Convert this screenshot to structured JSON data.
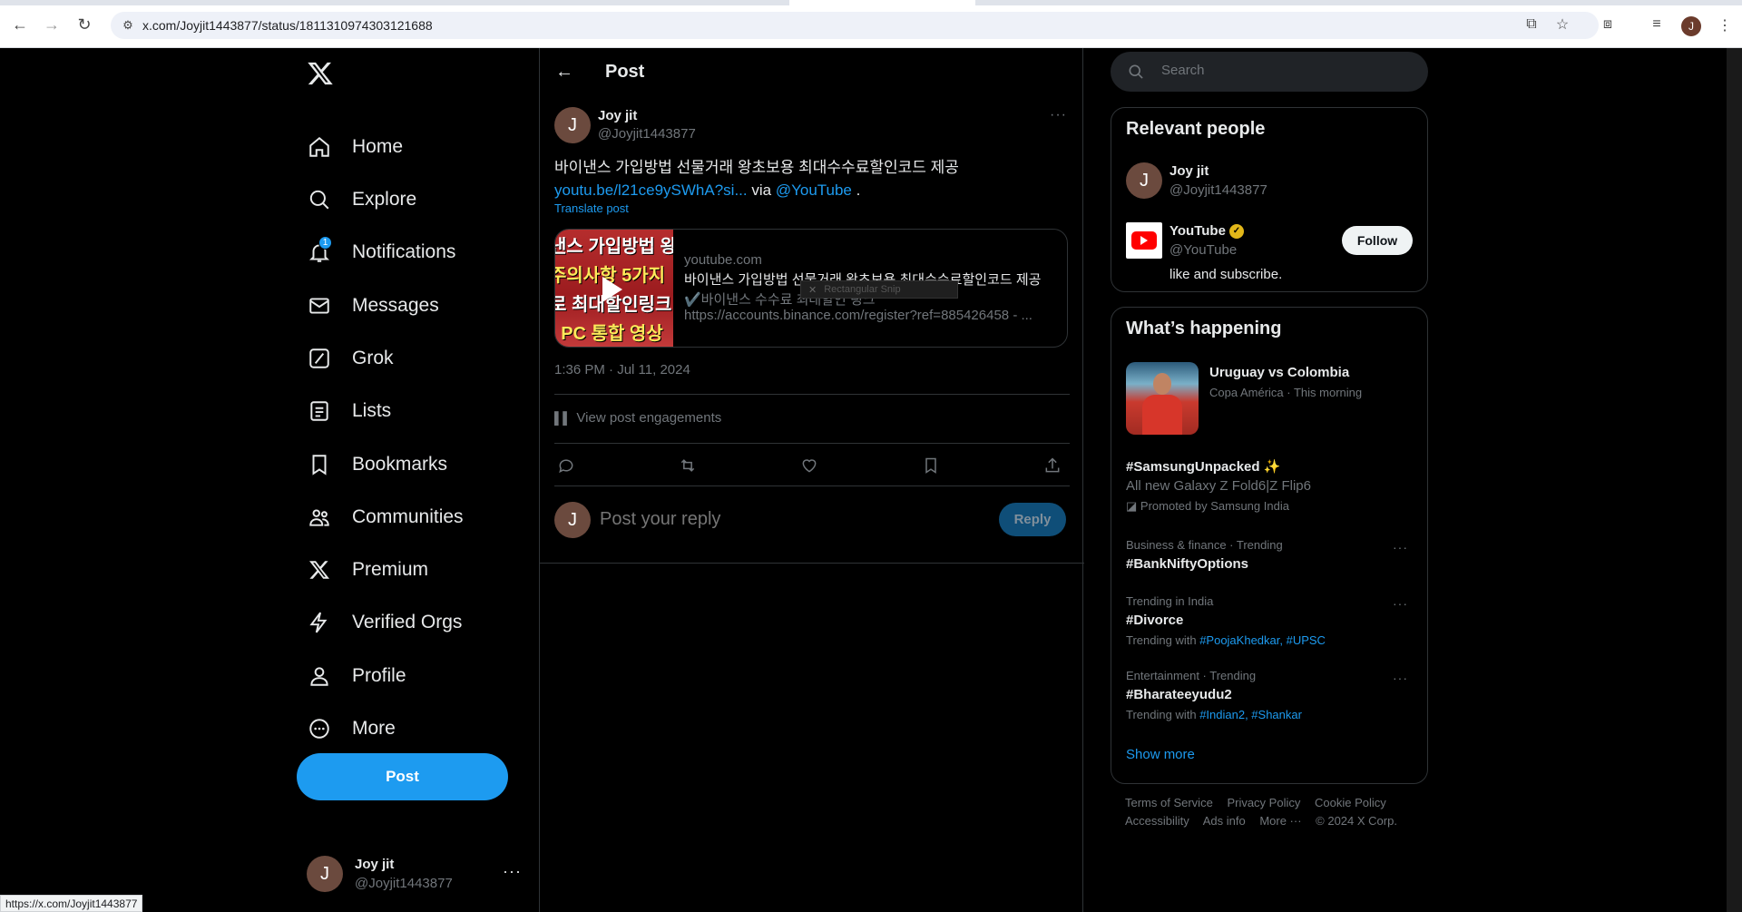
{
  "browser": {
    "url": "x.com/Joyjit1443877/status/1811310974303121688",
    "profile_initial": "J",
    "status_url": "https://x.com/Joyjit1443877"
  },
  "nav": {
    "items": [
      {
        "label": "Home",
        "icon": "home-icon"
      },
      {
        "label": "Explore",
        "icon": "search-icon"
      },
      {
        "label": "Notifications",
        "icon": "bell-icon"
      },
      {
        "label": "Messages",
        "icon": "envelope-icon"
      },
      {
        "label": "Grok",
        "icon": "grok-icon"
      },
      {
        "label": "Lists",
        "icon": "list-icon"
      },
      {
        "label": "Bookmarks",
        "icon": "bookmark-icon"
      },
      {
        "label": "Communities",
        "icon": "people-icon"
      },
      {
        "label": "Premium",
        "icon": "x-logo-icon"
      },
      {
        "label": "Verified Orgs",
        "icon": "lightning-icon"
      },
      {
        "label": "Profile",
        "icon": "person-icon"
      },
      {
        "label": "More",
        "icon": "more-circle-icon"
      }
    ],
    "notification_count": "1",
    "post_button": "Post",
    "account": {
      "initial": "J",
      "name": "Joy jit",
      "handle": "@Joyjit1443877"
    }
  },
  "header": {
    "title": "Post"
  },
  "post": {
    "author": {
      "initial": "J",
      "name": "Joy jit",
      "handle": "@Joyjit1443877"
    },
    "text": "바이낸스 가입방법 선물거래 왕초보용 최대수수료할인코드 제공",
    "link": "youtu.be/l21ce9ySWhA?si...",
    "via": "via",
    "mention": "@YouTube",
    "period": ".",
    "translate": "Translate post",
    "card": {
      "thumb_lines": [
        "낸스 가입방법 왕초",
        "주의사항 5가지",
        "로 최대할인링크 제",
        "! PC 통합 영상"
      ],
      "domain": "youtube.com",
      "title": "바이낸스 가입방법 선물거래 왕초보용 최대수수료할인코드 제공",
      "desc1": "✔️바이낸스 수수료 최대할인 링크",
      "desc2": "https://accounts.binance.com/register?ref=885426458 - ..."
    },
    "snip_label": "Rectangular Snip",
    "timestamp": "1:36 PM · Jul 11, 2024",
    "engagements": "View post engagements",
    "reply_placeholder": "Post your reply",
    "reply_button": "Reply"
  },
  "search": {
    "placeholder": "Search"
  },
  "relevant": {
    "title": "Relevant people",
    "people": [
      {
        "initial": "J",
        "name": "Joy jit",
        "handle": "@Joyjit1443877"
      },
      {
        "name": "YouTube",
        "handle": "@YouTube",
        "bio": "like and subscribe.",
        "follow": "Follow"
      }
    ]
  },
  "happening": {
    "title": "What’s happening",
    "featured": {
      "title": "Uruguay vs Colombia",
      "sub": "Copa América · This morning"
    },
    "promoted": {
      "tag": "#SamsungUnpacked",
      "emoji": "✨",
      "desc": "All new Galaxy Z Fold6|Z Flip6",
      "by": "Promoted by Samsung India"
    },
    "trends": [
      {
        "context": "Business & finance · Trending",
        "name": "#BankNiftyOptions"
      },
      {
        "context": "Trending in India",
        "name": "#Divorce",
        "with_label": "Trending with",
        "with": "#PoojaKhedkar, #UPSC"
      },
      {
        "context": "Entertainment · Trending",
        "name": "#Bharateeyudu2",
        "with_label": "Trending with",
        "with": "#Indian2, #Shankar"
      }
    ],
    "show_more": "Show more"
  },
  "footer": {
    "row1": [
      "Terms of Service",
      "Privacy Policy",
      "Cookie Policy"
    ],
    "row2": [
      "Accessibility",
      "Ads info",
      "More ···",
      "© 2024 X Corp."
    ]
  }
}
